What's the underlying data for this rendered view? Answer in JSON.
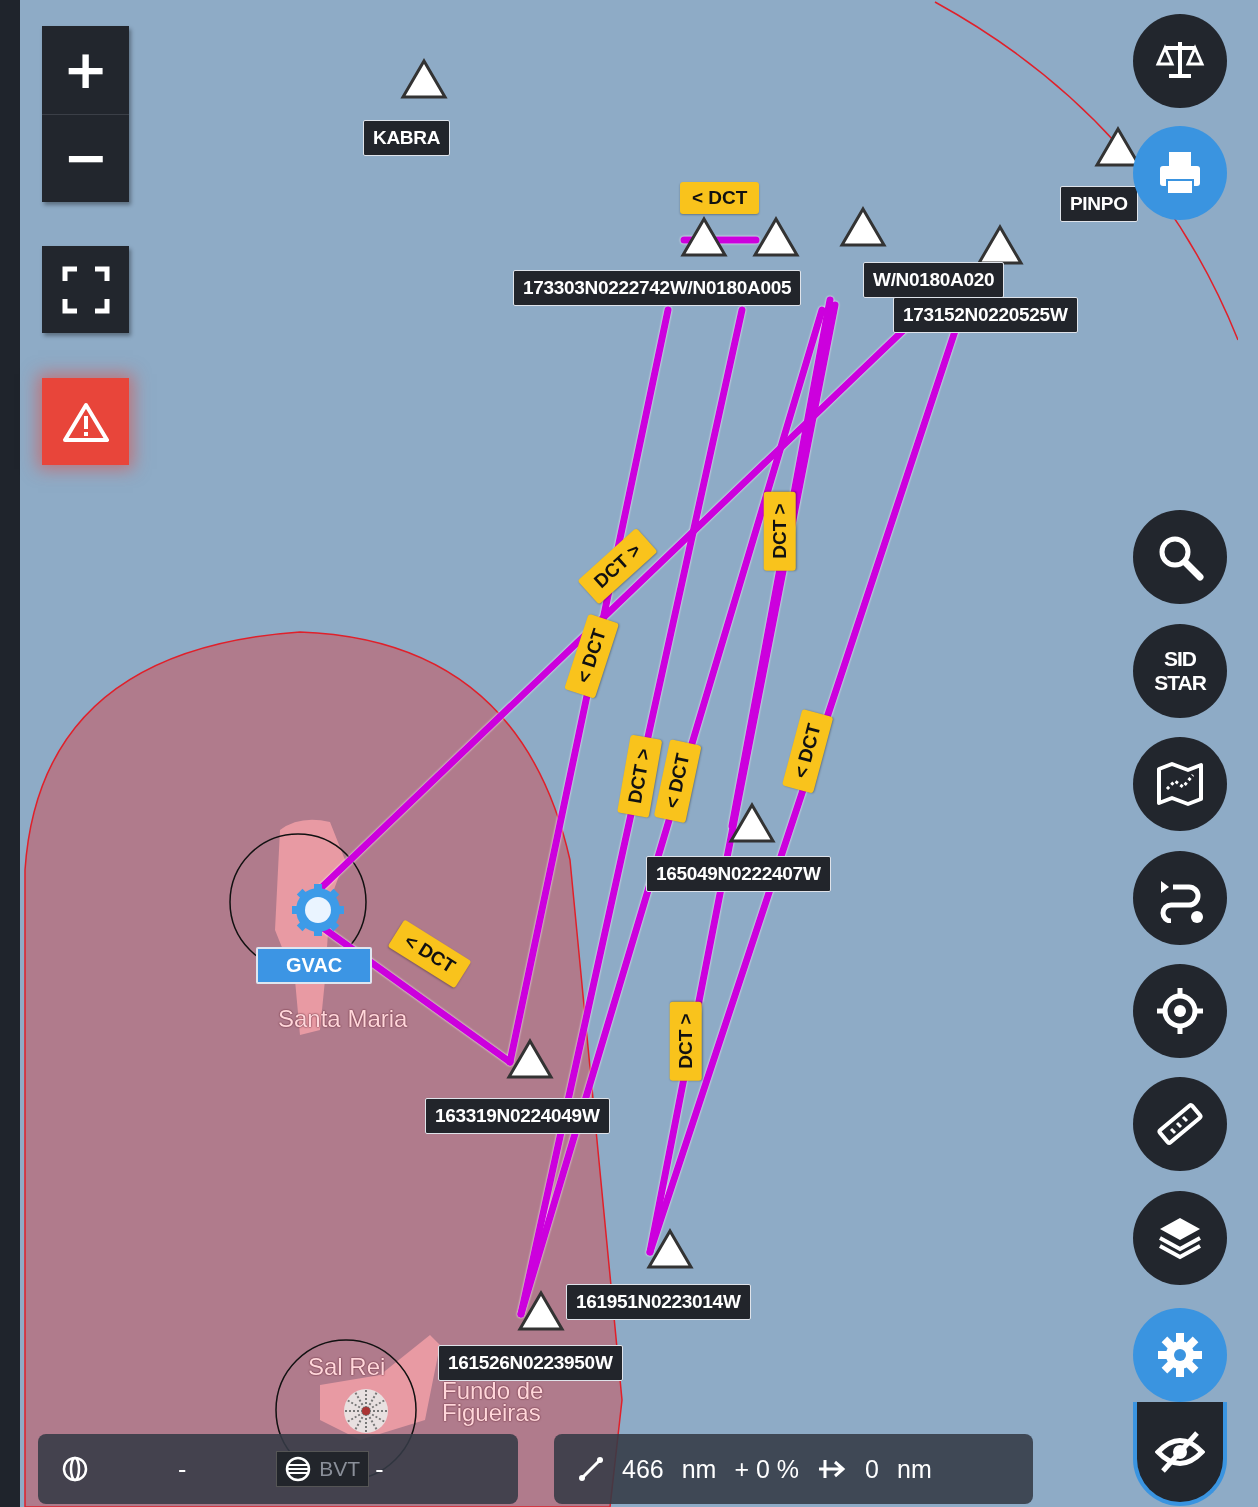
{
  "zoom_controls": {
    "zoom_in": "+",
    "zoom_out": "−"
  },
  "waypoints": [
    {
      "label": "KABRA"
    },
    {
      "label": "PINPO"
    },
    {
      "label": "W/N0180A020"
    },
    {
      "label": "173152N0220525W"
    },
    {
      "label": "173303N0222742W/N0180A005"
    },
    {
      "label": "165049N0222407W"
    },
    {
      "label": "163319N0224049W"
    },
    {
      "label": "161951N0223014W"
    },
    {
      "label": "161526N0223950W"
    }
  ],
  "airport": {
    "label": "GVAC"
  },
  "route_tags": [
    {
      "text": "< DCT"
    },
    {
      "text": "DCT >"
    },
    {
      "text": "< DCT"
    },
    {
      "text": "DCT >"
    },
    {
      "text": "DCT >"
    },
    {
      "text": "< DCT"
    },
    {
      "text": "< DCT"
    },
    {
      "text": "< DCT"
    },
    {
      "text": "DCT >"
    }
  ],
  "places": [
    {
      "name": "Santa Maria"
    },
    {
      "name": "Sal Rei"
    },
    {
      "name": "Fundo de\nFigueiras"
    }
  ],
  "right_tools": [
    {
      "kind": "icon",
      "active": false
    },
    {
      "kind": "icon",
      "active": true
    },
    {
      "kind": "icon",
      "active": false
    },
    {
      "kind": "text",
      "text": "SID\nSTAR",
      "active": false
    },
    {
      "kind": "icon",
      "active": false
    },
    {
      "kind": "icon",
      "active": false
    },
    {
      "kind": "icon",
      "active": false
    },
    {
      "kind": "icon",
      "active": false
    },
    {
      "kind": "icon",
      "active": false
    },
    {
      "kind": "icon",
      "active": true
    },
    {
      "kind": "icon",
      "active": false
    }
  ],
  "departure_bar": {
    "left_value": "-",
    "airport": "BVT",
    "right_value": "-"
  },
  "distance_bar": {
    "distance": "466",
    "distance_unit": "nm",
    "percent": "+ 0 %",
    "extra": "0",
    "extra_unit": "nm"
  }
}
